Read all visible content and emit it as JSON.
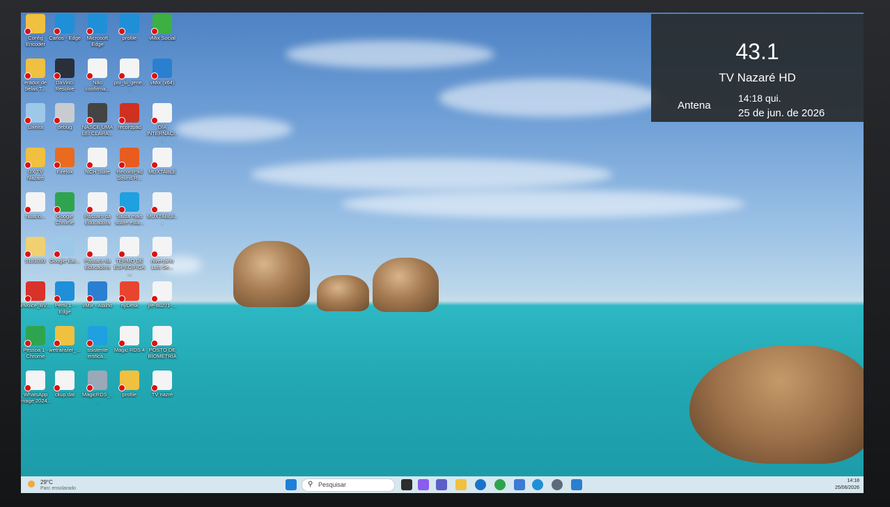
{
  "overlay": {
    "channel": "43.1",
    "station": "TV Nazaré HD",
    "source": "Antena",
    "time": "14:18  qui.",
    "date": "25 de jun. de 2026"
  },
  "desktop": {
    "icons": [
      {
        "label": "Config Encoder",
        "color": "#f0c040"
      },
      {
        "label": "Carlos - Edge",
        "color": "#1f8fd8"
      },
      {
        "label": "Microsoft Edge",
        "color": "#1f8fd8"
      },
      {
        "label": "profile",
        "color": "#1f8fd8"
      },
      {
        "label": "vMix Social",
        "color": "#3cb043"
      },
      {
        "label": "erador de belas T...",
        "color": "#f0c040"
      },
      {
        "label": "DaVinci Resolve",
        "color": "#2a2f3a"
      },
      {
        "label": "Não confirma...",
        "color": "#f4f4f4"
      },
      {
        "label": "psi_si_gene...",
        "color": "#f4f4f4"
      },
      {
        "label": "vMix (x64)",
        "color": "#2b7fd0"
      },
      {
        "label": "Lixeira",
        "color": "#9ec8e8"
      },
      {
        "label": "debug",
        "color": "#c8ccd0"
      },
      {
        "label": "NASCE UMA LEI CLARA...",
        "color": "#444"
      },
      {
        "label": "recordpad",
        "color": "#d03020"
      },
      {
        "label": "DIA INTERNACI...",
        "color": "#f4f4f4"
      },
      {
        "label": "UX TV Nazaré",
        "color": "#f0c040"
      },
      {
        "label": "Firefox",
        "color": "#e86b1f"
      },
      {
        "label": "NCH Suite",
        "color": "#f4f4f4"
      },
      {
        "label": "RecordPad Sound R...",
        "color": "#e85c1f"
      },
      {
        "label": "MUXTABLE",
        "color": "#f4f4f4"
      },
      {
        "label": "niuario...",
        "color": "#f4f4f4"
      },
      {
        "label": "Google Chrome",
        "color": "#2fa44f"
      },
      {
        "label": "Pássaro da Educadora",
        "color": "#f4f4f4"
      },
      {
        "label": "Saiba mais sobre esta...",
        "color": "#1fa0e0"
      },
      {
        "label": "MUXTABLE...",
        "color": "#f4f4f4"
      },
      {
        "label": "0181093",
        "color": "#f0d070"
      },
      {
        "label": "Google Ear...",
        "color": "#9ec8e8"
      },
      {
        "label": "Pássaro da Educadora",
        "color": "#f4f4f4"
      },
      {
        "label": "TERMO DE ESPECIFICA...",
        "color": "#f4f4f4"
      },
      {
        "label": "niversário Luis Se...",
        "color": "#f4f4f4"
      },
      {
        "label": "invoice_BV...",
        "color": "#d8322a"
      },
      {
        "label": "Perfil 1 - Edge",
        "color": "#1f8fd8"
      },
      {
        "label": "vMix - Atalho",
        "color": "#2b7fd0"
      },
      {
        "label": "nyDesk",
        "color": "#e8452f"
      },
      {
        "label": "jre-8u271-...",
        "color": "#f4f4f4"
      },
      {
        "label": "Pessoa 1 - Chrome",
        "color": "#2fa44f"
      },
      {
        "label": "wetransfer_...",
        "color": "#f0c040"
      },
      {
        "label": "ssistente ertifica...",
        "color": "#1fa0e0"
      },
      {
        "label": "Magic RDS 4",
        "color": "#f4f4f4"
      },
      {
        "label": "POSTO DE BIOMETRIA",
        "color": "#f4f4f4"
      },
      {
        "label": "WhatsApp Image 2024...",
        "color": "#f4f4f4"
      },
      {
        "label": "ckup.dat",
        "color": "#f4f4f4"
      },
      {
        "label": "MagicRDS_...",
        "color": "#9aa8b8"
      },
      {
        "label": "profile",
        "color": "#f0c040"
      },
      {
        "label": "TV nazré",
        "color": "#f4f4f4"
      }
    ]
  },
  "taskbar": {
    "weather_temp": "29°C",
    "weather_desc": "Parc ensolarado",
    "search_placeholder": "Pesquisar",
    "clock_time": "14:18",
    "clock_date": "25/06/2026"
  }
}
